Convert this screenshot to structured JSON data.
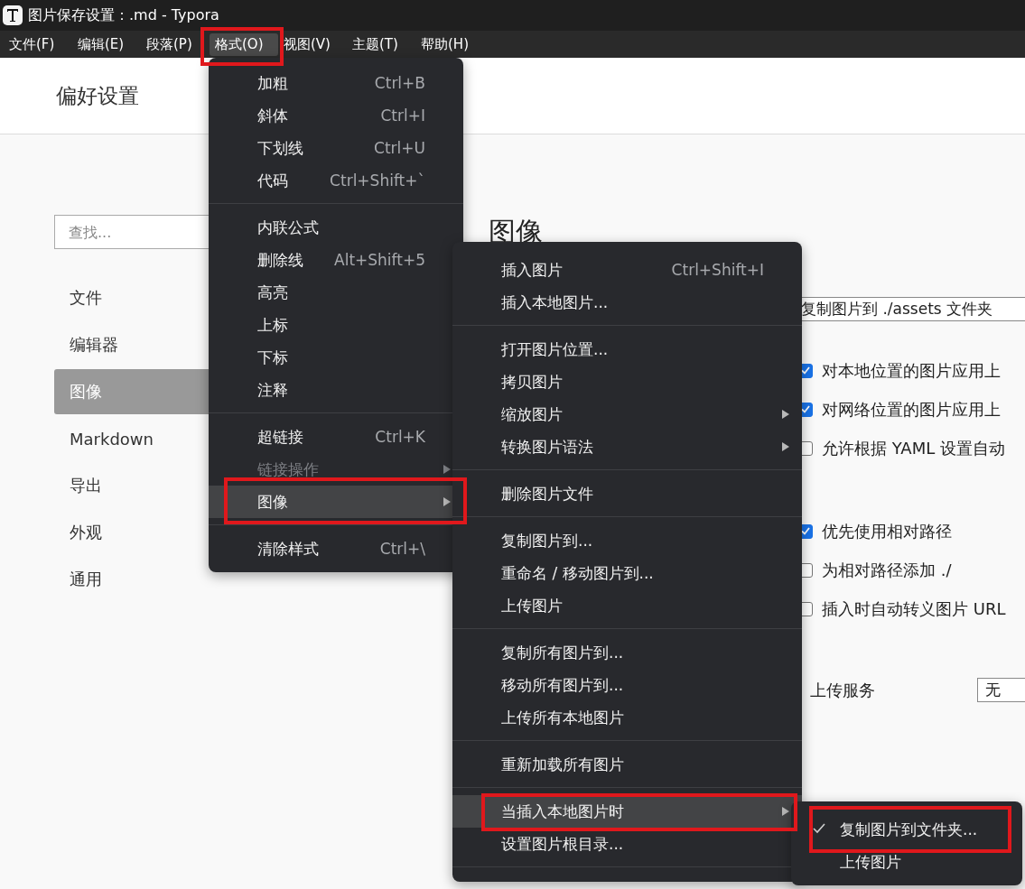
{
  "window": {
    "title": "图片保存设置：.md - Typora"
  },
  "menubar": [
    {
      "label": "文件(F)",
      "selected": false,
      "annotated": false
    },
    {
      "label": "编辑(E)",
      "selected": false,
      "annotated": false
    },
    {
      "label": "段落(P)",
      "selected": false,
      "annotated": false
    },
    {
      "label": "格式(O)",
      "selected": true,
      "annotated": true
    },
    {
      "label": "视图(V)",
      "selected": false,
      "annotated": false
    },
    {
      "label": "主题(T)",
      "selected": false,
      "annotated": false
    },
    {
      "label": "帮助(H)",
      "selected": false,
      "annotated": false
    }
  ],
  "preferences": {
    "title": "偏好设置",
    "search": {
      "placeholder": "查找..."
    },
    "sidebar": [
      {
        "label": "文件",
        "selected": false
      },
      {
        "label": "编辑器",
        "selected": false
      },
      {
        "label": "图像",
        "selected": true
      },
      {
        "label": "Markdown",
        "selected": false
      },
      {
        "label": "导出",
        "selected": false
      },
      {
        "label": "外观",
        "selected": false
      },
      {
        "label": "通用",
        "selected": false
      }
    ],
    "section_title": "图像",
    "insert_action": {
      "value": "复制图片到 ./assets 文件夹"
    },
    "option_groups": [
      [
        {
          "label": "对本地位置的图片应用上",
          "checked": true
        },
        {
          "label": "对网络位置的图片应用上",
          "checked": true
        },
        {
          "label": "允许根据 YAML 设置自动",
          "checked": false
        }
      ],
      [
        {
          "label": "优先使用相对路径",
          "checked": true
        },
        {
          "label": "为相对路径添加 ./",
          "checked": false
        },
        {
          "label": "插入时自动转义图片 URL",
          "checked": false
        }
      ]
    ],
    "upload_service": {
      "label": "上传服务",
      "value": "无"
    }
  },
  "menus": [
    {
      "items": [
        {
          "kind": "item",
          "label": "加粗",
          "shortcut": "Ctrl+B",
          "disabled": false,
          "highlighted": false,
          "annotated": false
        },
        {
          "kind": "item",
          "label": "斜体",
          "shortcut": "Ctrl+I",
          "disabled": false,
          "highlighted": false,
          "annotated": false
        },
        {
          "kind": "item",
          "label": "下划线",
          "shortcut": "Ctrl+U",
          "disabled": false,
          "highlighted": false,
          "annotated": false
        },
        {
          "kind": "item",
          "label": "代码",
          "shortcut": "Ctrl+Shift+`",
          "disabled": false,
          "highlighted": false,
          "annotated": false
        },
        {
          "kind": "separator"
        },
        {
          "kind": "item",
          "label": "内联公式",
          "disabled": false,
          "highlighted": false,
          "annotated": false
        },
        {
          "kind": "item",
          "label": "删除线",
          "shortcut": "Alt+Shift+5",
          "disabled": false,
          "highlighted": false,
          "annotated": false
        },
        {
          "kind": "item",
          "label": "高亮",
          "disabled": false,
          "highlighted": false,
          "annotated": false
        },
        {
          "kind": "item",
          "label": "上标",
          "disabled": false,
          "highlighted": false,
          "annotated": false
        },
        {
          "kind": "item",
          "label": "下标",
          "disabled": false,
          "highlighted": false,
          "annotated": false
        },
        {
          "kind": "item",
          "label": "注释",
          "disabled": false,
          "highlighted": false,
          "annotated": false
        },
        {
          "kind": "separator"
        },
        {
          "kind": "item",
          "label": "超链接",
          "shortcut": "Ctrl+K",
          "disabled": false,
          "highlighted": false,
          "annotated": false
        },
        {
          "kind": "submenu",
          "label": "链接操作",
          "disabled": true,
          "highlighted": false,
          "annotated": false
        },
        {
          "kind": "submenu",
          "label": "图像",
          "disabled": false,
          "highlighted": true,
          "annotated": true
        },
        {
          "kind": "separator"
        },
        {
          "kind": "item",
          "label": "清除样式",
          "shortcut": "Ctrl+\\",
          "disabled": false,
          "highlighted": false,
          "annotated": false
        }
      ]
    },
    {
      "items": [
        {
          "kind": "item",
          "label": "插入图片",
          "shortcut": "Ctrl+Shift+I",
          "highlighted": false,
          "annotated": false
        },
        {
          "kind": "item",
          "label": "插入本地图片...",
          "highlighted": false,
          "annotated": false
        },
        {
          "kind": "separator"
        },
        {
          "kind": "item",
          "label": "打开图片位置...",
          "highlighted": false,
          "annotated": false
        },
        {
          "kind": "item",
          "label": "拷贝图片",
          "highlighted": false,
          "annotated": false
        },
        {
          "kind": "submenu",
          "label": "缩放图片",
          "highlighted": false,
          "annotated": false
        },
        {
          "kind": "submenu",
          "label": "转换图片语法",
          "highlighted": false,
          "annotated": false
        },
        {
          "kind": "separator"
        },
        {
          "kind": "item",
          "label": "删除图片文件",
          "highlighted": false,
          "annotated": false
        },
        {
          "kind": "separator"
        },
        {
          "kind": "item",
          "label": "复制图片到...",
          "highlighted": false,
          "annotated": false
        },
        {
          "kind": "item",
          "label": "重命名 / 移动图片到...",
          "highlighted": false,
          "annotated": false
        },
        {
          "kind": "item",
          "label": "上传图片",
          "highlighted": false,
          "annotated": false
        },
        {
          "kind": "separator"
        },
        {
          "kind": "item",
          "label": "复制所有图片到...",
          "highlighted": false,
          "annotated": false
        },
        {
          "kind": "item",
          "label": "移动所有图片到...",
          "highlighted": false,
          "annotated": false
        },
        {
          "kind": "item",
          "label": "上传所有本地图片",
          "highlighted": false,
          "annotated": false
        },
        {
          "kind": "separator"
        },
        {
          "kind": "item",
          "label": "重新加载所有图片",
          "highlighted": false,
          "annotated": false
        },
        {
          "kind": "separator"
        },
        {
          "kind": "submenu",
          "label": "当插入本地图片时",
          "highlighted": true,
          "annotated": true
        },
        {
          "kind": "item",
          "label": "设置图片根目录...",
          "highlighted": false,
          "annotated": false
        },
        {
          "kind": "separator"
        }
      ]
    },
    {
      "items": [
        {
          "kind": "check",
          "label": "复制图片到文件夹...",
          "checked": true,
          "highlighted": false,
          "annotated": true
        },
        {
          "kind": "check",
          "label": "上传图片",
          "checked": false,
          "highlighted": false,
          "annotated": false
        }
      ]
    }
  ]
}
